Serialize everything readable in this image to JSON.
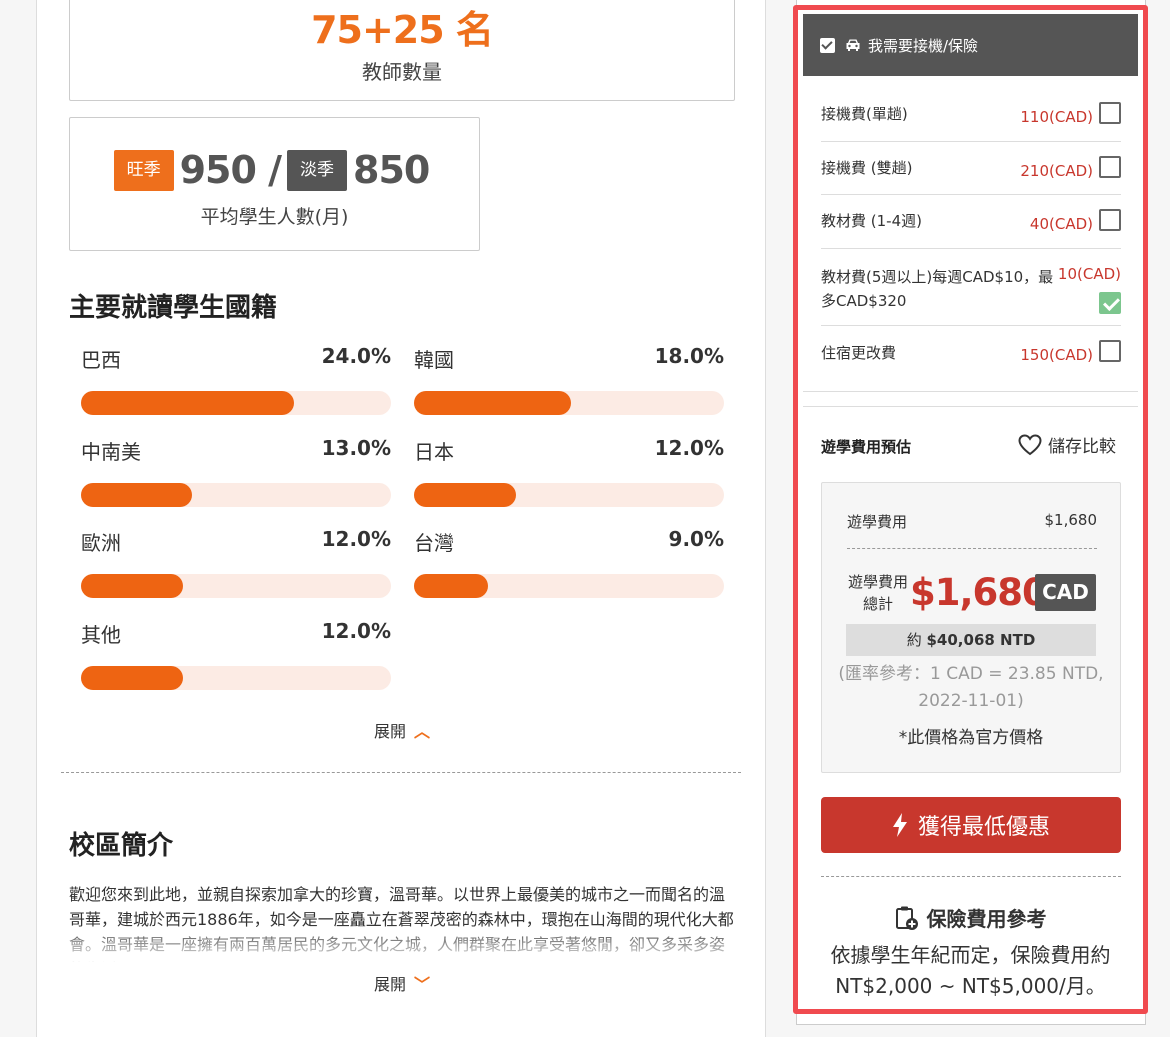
{
  "teachers": {
    "count": "75+25 名",
    "label": "教師數量"
  },
  "students": {
    "peak_tag": "旺季",
    "peak_value": "950 /",
    "off_tag": "淡季",
    "off_value": "850",
    "label": "平均學生人數(月)"
  },
  "nationality": {
    "title": "主要就讀學生國籍",
    "items": [
      {
        "name": "巴西",
        "pct": "24.0%",
        "value": 24.0
      },
      {
        "name": "韓國",
        "pct": "18.0%",
        "value": 18.0
      },
      {
        "name": "中南美",
        "pct": "13.0%",
        "value": 13.0
      },
      {
        "name": "日本",
        "pct": "12.0%",
        "value": 12.0
      },
      {
        "name": "歐洲",
        "pct": "12.0%",
        "value": 12.0
      },
      {
        "name": "台灣",
        "pct": "9.0%",
        "value": 9.0
      },
      {
        "name": "其他",
        "pct": "12.0%",
        "value": 12.0
      }
    ],
    "expand_label": "展開"
  },
  "campus": {
    "title": "校區簡介",
    "text": "歡迎您來到此地，並親自探索加拿大的珍寶，溫哥華。以世界上最優美的城市之一而聞名的溫哥華，建城於西元1886年，如今是一座矗立在蒼翠茂密的森林中，環抱在山海間的現代化大都會。溫哥華是一座擁有兩百萬居民的多元文化之城，人們群聚在此享受著悠閒，卻又多采多姿的生活。",
    "expand_label": "展開"
  },
  "addons": {
    "header": "我需要接機/保險",
    "items": [
      {
        "name": "接機費(單趟)",
        "price": "110(CAD)",
        "checked": false
      },
      {
        "name": "接機費 (雙趟)",
        "price": "210(CAD)",
        "checked": false
      },
      {
        "name": "教材費 (1-4週)",
        "price": "40(CAD)",
        "checked": false
      },
      {
        "name": "教材費(5週以上)每週CAD$10，最多CAD$320",
        "name_line1": "教材費(5週以上)每週CAD$10，最",
        "name_line2": "多CAD$320",
        "price": "10(CAD)",
        "checked": true
      },
      {
        "name": "住宿更改費",
        "price": "150(CAD)",
        "checked": false
      }
    ]
  },
  "estimate": {
    "title": "遊學費用預估",
    "save_label": "儲存比較",
    "fee_label": "遊學費用",
    "fee_value": "$1,680",
    "total_label_1": "遊學費用",
    "total_label_2": "總計",
    "total_value": "$1,680",
    "currency": "CAD",
    "ntd_prefix": "約",
    "ntd_value": "$40,068 NTD",
    "rate_note": "(匯率參考：1 CAD = 23.85 NTD, 2022-11-01)",
    "official_note": "*此價格為官方價格"
  },
  "cta": {
    "label": "獲得最低優惠"
  },
  "insurance": {
    "title": "保險費用參考",
    "desc": "依據學生年紀而定，保險費用約NT$2,000 ~ NT$5,000/月。"
  },
  "colors": {
    "accent": "#ee6f1c",
    "price_red": "#c8372d",
    "dark": "#555555",
    "highlight": "#f04a4f",
    "check_green": "#7cc68e"
  }
}
